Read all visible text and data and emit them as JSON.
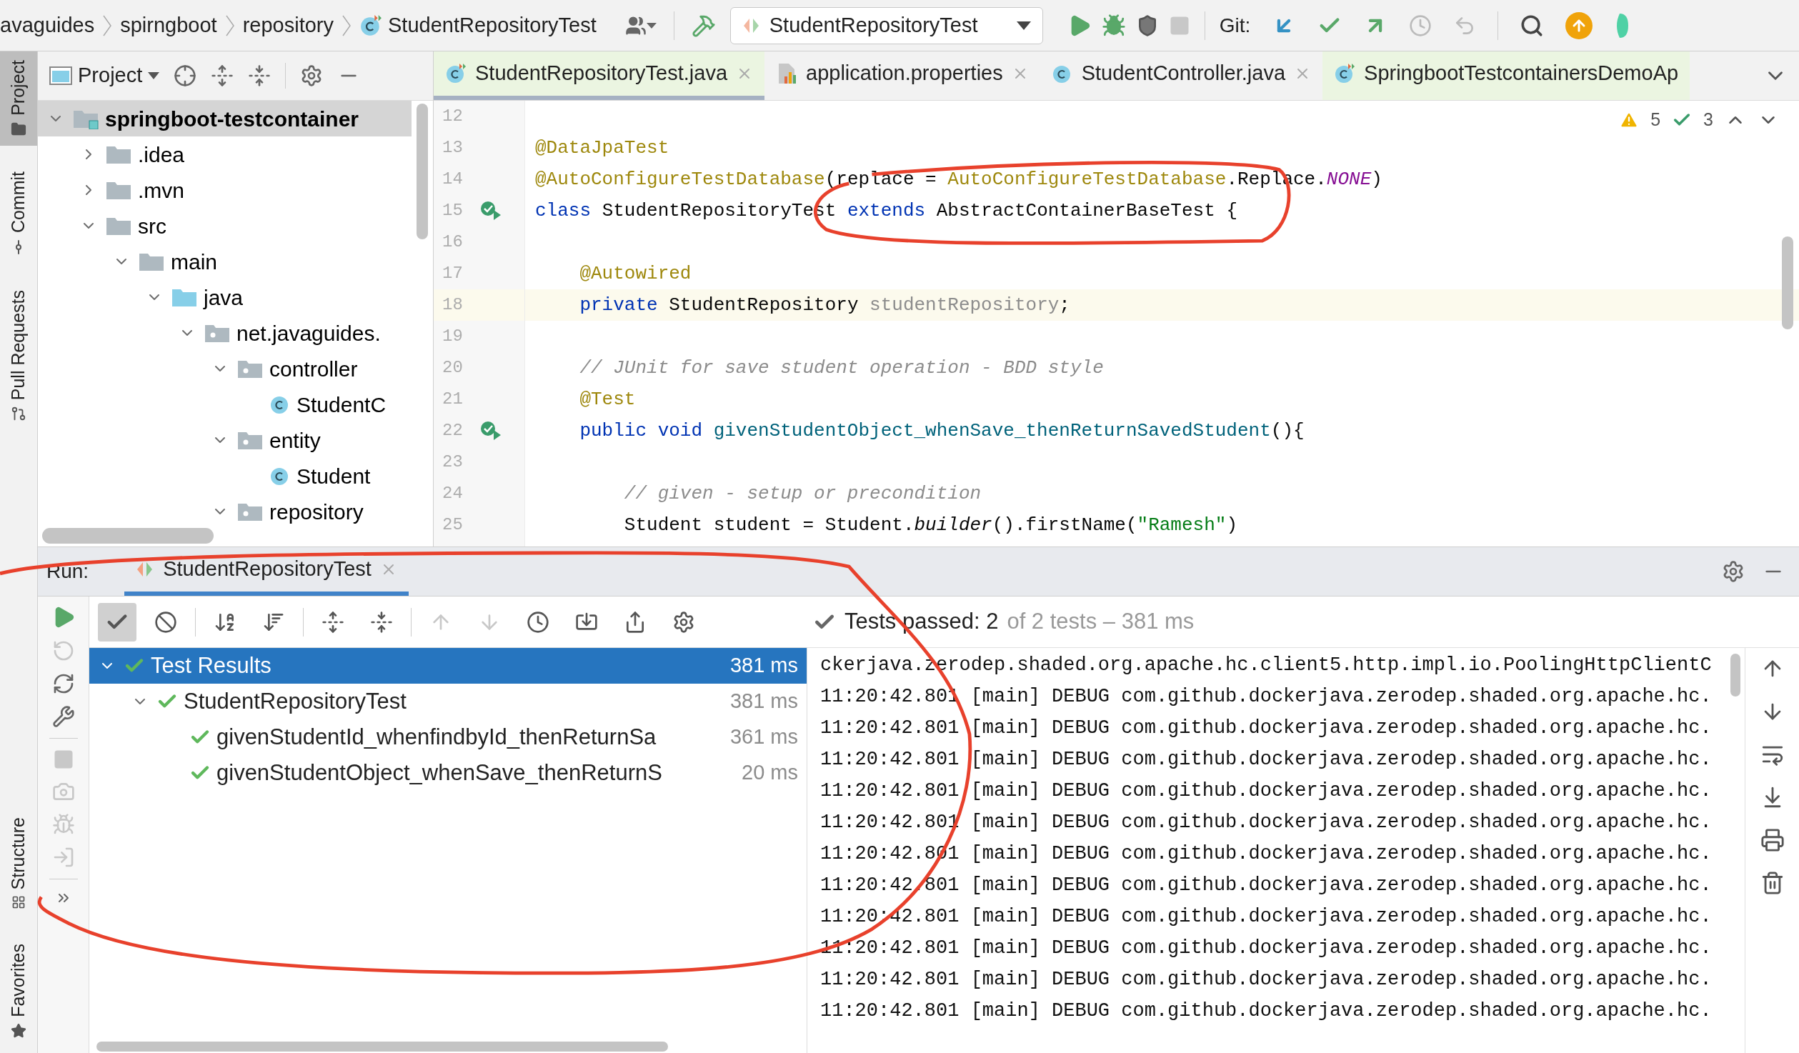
{
  "breadcrumbs": [
    {
      "label": "avaguides",
      "kind": "folder"
    },
    {
      "label": "spirngboot",
      "kind": "folder"
    },
    {
      "label": "repository",
      "kind": "folder"
    },
    {
      "label": "StudentRepositoryTest",
      "kind": "test-class"
    }
  ],
  "run_config": {
    "label": "StudentRepositoryTest"
  },
  "git": {
    "label": "Git:"
  },
  "stripe_top": [
    {
      "label": "Project",
      "selected": true,
      "kind": "project"
    },
    {
      "label": "Commit",
      "selected": false,
      "kind": "commit"
    },
    {
      "label": "Pull Requests",
      "selected": false,
      "kind": "pull"
    }
  ],
  "stripe_bottom": [
    {
      "label": "Structure",
      "selected": false,
      "kind": "structure"
    },
    {
      "label": "Favorites",
      "selected": false,
      "kind": "favorites"
    }
  ],
  "project_panel": {
    "title": "Project",
    "tree": [
      {
        "label": "springboot-testcontainer",
        "kind": "module",
        "expanded": true,
        "selected": true,
        "children": [
          {
            "label": ".idea",
            "kind": "folder",
            "expanded": false,
            "selected": false
          },
          {
            "label": ".mvn",
            "kind": "folder",
            "expanded": false,
            "selected": false
          },
          {
            "label": "src",
            "kind": "folder",
            "expanded": true,
            "selected": false,
            "children": [
              {
                "label": "main",
                "kind": "folder",
                "expanded": true,
                "selected": false,
                "children": [
                  {
                    "label": "java",
                    "kind": "source",
                    "expanded": true,
                    "selected": false,
                    "children": [
                      {
                        "label": "net.javaguides.",
                        "kind": "package",
                        "expanded": true,
                        "selected": false,
                        "children": [
                          {
                            "label": "controller",
                            "kind": "package",
                            "expanded": true,
                            "selected": false,
                            "children": [
                              {
                                "label": "StudentC",
                                "kind": "class",
                                "selected": false
                              }
                            ]
                          },
                          {
                            "label": "entity",
                            "kind": "package",
                            "expanded": true,
                            "selected": false,
                            "children": [
                              {
                                "label": "Student",
                                "kind": "class",
                                "selected": false
                              }
                            ]
                          },
                          {
                            "label": "repository",
                            "kind": "package",
                            "expanded": true,
                            "selected": false
                          }
                        ]
                      }
                    ]
                  }
                ]
              }
            ]
          }
        ]
      }
    ]
  },
  "editor": {
    "tabs": [
      {
        "label": "StudentRepositoryTest.java",
        "kind": "test-class",
        "selected": true,
        "test_file": true,
        "closable": true
      },
      {
        "label": "application.properties",
        "kind": "properties",
        "selected": false,
        "test_file": false,
        "closable": true
      },
      {
        "label": "StudentController.java",
        "kind": "class",
        "selected": false,
        "test_file": false,
        "closable": true
      },
      {
        "label": "SpringbootTestcontainersDemoAp",
        "kind": "test-class",
        "selected": false,
        "test_file": true,
        "closable": false
      }
    ],
    "warnings": "5",
    "weak_warnings": "3",
    "lines": [
      {
        "number": "12",
        "current": false,
        "run_marker": false
      },
      {
        "number": "13",
        "current": false,
        "run_marker": false,
        "tokens": [
          {
            "text": "@DataJpaTest",
            "kind": "annotation"
          }
        ]
      },
      {
        "number": "14",
        "current": false,
        "run_marker": false,
        "tokens": [
          {
            "text": "@AutoConfigureTestDatabase",
            "kind": "annotation"
          },
          {
            "text": "(replace = ",
            "kind": "plain"
          },
          {
            "text": "AutoConfigureTestDatabase",
            "kind": "annotation"
          },
          {
            "text": ".Replace.",
            "kind": "plain"
          },
          {
            "text": "NONE",
            "kind": "constant"
          },
          {
            "text": ")",
            "kind": "plain"
          }
        ]
      },
      {
        "number": "15",
        "current": false,
        "run_marker": true,
        "tokens": [
          {
            "text": "class ",
            "kind": "keyword"
          },
          {
            "text": "StudentRepositoryTest ",
            "kind": "plain"
          },
          {
            "text": "extends ",
            "kind": "keyword"
          },
          {
            "text": "AbstractContainerBaseTest {",
            "kind": "plain"
          }
        ]
      },
      {
        "number": "16",
        "current": false,
        "run_marker": false
      },
      {
        "number": "17",
        "current": false,
        "run_marker": false,
        "tokens": [
          {
            "text": "    @Autowired",
            "kind": "annotation"
          }
        ]
      },
      {
        "number": "18",
        "current": true,
        "run_marker": false,
        "tokens": [
          {
            "text": "    private ",
            "kind": "keyword"
          },
          {
            "text": "StudentRepository ",
            "kind": "plain"
          },
          {
            "text": "studentRepository",
            "kind": "unused"
          },
          {
            "text": ";",
            "kind": "plain"
          }
        ]
      },
      {
        "number": "19",
        "current": false,
        "run_marker": false
      },
      {
        "number": "20",
        "current": false,
        "run_marker": false,
        "tokens": [
          {
            "text": "    // JUnit for save student operation - BDD style",
            "kind": "comment"
          }
        ]
      },
      {
        "number": "21",
        "current": false,
        "run_marker": false,
        "tokens": [
          {
            "text": "    @Test",
            "kind": "annotation"
          }
        ]
      },
      {
        "number": "22",
        "current": false,
        "run_marker": true,
        "tokens": [
          {
            "text": "    public void ",
            "kind": "keyword"
          },
          {
            "text": "givenStudentObject_whenSave_thenReturnSavedStudent",
            "kind": "method"
          },
          {
            "text": "(){",
            "kind": "plain"
          }
        ]
      },
      {
        "number": "23",
        "current": false,
        "run_marker": false
      },
      {
        "number": "24",
        "current": false,
        "run_marker": false,
        "tokens": [
          {
            "text": "        // given - setup or precondition",
            "kind": "comment"
          }
        ]
      },
      {
        "number": "25",
        "current": false,
        "run_marker": false,
        "tokens": [
          {
            "text": "        Student student = Student.",
            "kind": "plain"
          },
          {
            "text": "builder",
            "kind": "italic"
          },
          {
            "text": "().firstName(",
            "kind": "plain"
          },
          {
            "text": "\"Ramesh\"",
            "kind": "string"
          },
          {
            "text": ")",
            "kind": "plain"
          }
        ]
      }
    ]
  },
  "run_panel": {
    "label": "Run:",
    "tabs": [
      {
        "label": "StudentRepositoryTest",
        "selected": true
      }
    ],
    "status": {
      "passed": "Tests passed: 2",
      "detail": "of 2 tests – 381 ms"
    },
    "results": [
      {
        "name": "Test Results",
        "duration": "381 ms",
        "passed": true,
        "selected": true,
        "expanded": true,
        "children": [
          {
            "name": "StudentRepositoryTest",
            "duration": "381 ms",
            "passed": true,
            "selected": false,
            "expanded": true,
            "children": [
              {
                "name": "givenStudentId_whenfindbyId_thenReturnSa",
                "duration": "361 ms",
                "passed": true,
                "selected": false
              },
              {
                "name": "givenStudentObject_whenSave_thenReturnS",
                "duration": "20 ms",
                "passed": true,
                "selected": false
              }
            ]
          }
        ]
      }
    ],
    "console": [
      "ckerjava.zerodep.shaded.org.apache.hc.client5.http.impl.io.PoolingHttpClientC",
      "11:20:42.801 [main] DEBUG com.github.dockerjava.zerodep.shaded.org.apache.hc.",
      "11:20:42.801 [main] DEBUG com.github.dockerjava.zerodep.shaded.org.apache.hc.",
      "11:20:42.801 [main] DEBUG com.github.dockerjava.zerodep.shaded.org.apache.hc.",
      "11:20:42.801 [main] DEBUG com.github.dockerjava.zerodep.shaded.org.apache.hc.",
      "11:20:42.801 [main] DEBUG com.github.dockerjava.zerodep.shaded.org.apache.hc.",
      "11:20:42.801 [main] DEBUG com.github.dockerjava.zerodep.shaded.org.apache.hc.",
      "11:20:42.801 [main] DEBUG com.github.dockerjava.zerodep.shaded.org.apache.hc.",
      "11:20:42.801 [main] DEBUG com.github.dockerjava.zerodep.shaded.org.apache.hc.",
      "11:20:42.801 [main] DEBUG com.github.dockerjava.zerodep.shaded.org.apache.hc.",
      "11:20:42.801 [main] DEBUG com.github.dockerjava.zerodep.shaded.org.apache.hc.",
      "11:20:42.801 [main] DEBUG com.github.dockerjava.zerodep.shaded.org.apache.hc."
    ]
  }
}
